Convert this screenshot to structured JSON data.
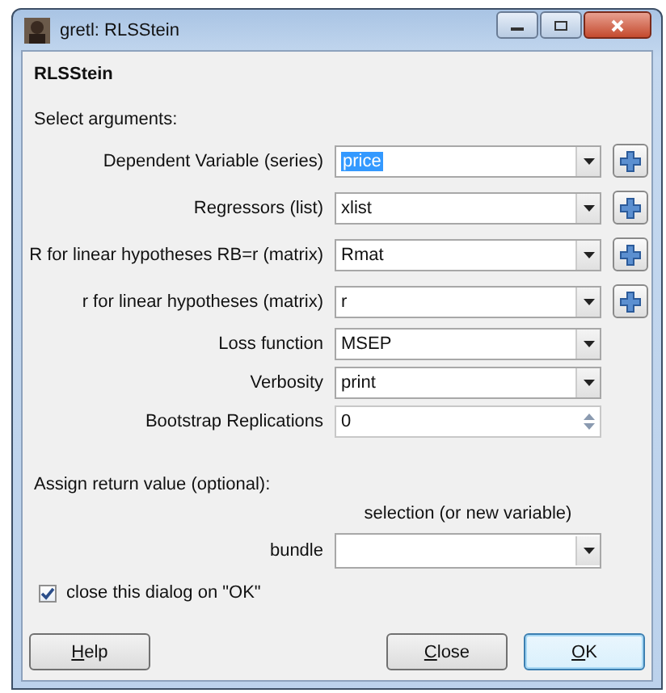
{
  "window": {
    "title": "gretl: RLSStein"
  },
  "heading": "RLSStein",
  "section_label": "Select arguments:",
  "arguments": [
    {
      "label": "Dependent Variable (series)",
      "kind": "combo",
      "value": "price",
      "text_selected": true,
      "add_button": true
    },
    {
      "label": "Regressors (list)",
      "kind": "combo",
      "value": "xlist",
      "text_selected": false,
      "add_button": true
    },
    {
      "label": "R for linear hypotheses RB=r (matrix)",
      "kind": "combo",
      "value": "Rmat",
      "text_selected": false,
      "add_button": true
    },
    {
      "label": "r for linear hypotheses (matrix)",
      "kind": "combo",
      "value": "r",
      "text_selected": false,
      "add_button": true
    },
    {
      "label": "Loss function",
      "kind": "combo",
      "value": "MSEP",
      "text_selected": false,
      "add_button": false
    },
    {
      "label": "Verbosity",
      "kind": "combo",
      "value": "print",
      "text_selected": false,
      "add_button": false
    },
    {
      "label": "Bootstrap Replications",
      "kind": "spin",
      "value": "0",
      "text_selected": false,
      "add_button": false
    }
  ],
  "return_section": {
    "label": "Assign return value (optional):",
    "column_heading": "selection (or new variable)",
    "type_label": "bundle"
  },
  "close_checkbox": {
    "label": "close this dialog on \"OK\"",
    "checked": true
  },
  "buttons": [
    {
      "label": "Help",
      "default": false
    },
    {
      "label": "Close",
      "default": false
    },
    {
      "label": "OK",
      "default": true
    }
  ]
}
